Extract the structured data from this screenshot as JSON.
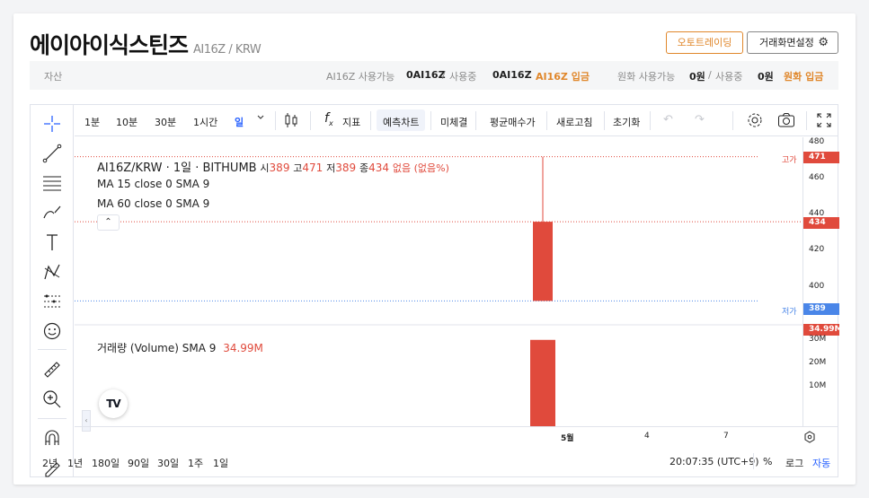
{
  "header": {
    "title": "에이아이식스틴즈",
    "pair": "AI16Z / KRW",
    "auto_trading_label": "오토트레이딩",
    "screen_settings_label": "거래화면설정"
  },
  "assets": {
    "label": "자산",
    "coin_available_label": "AI16Z 사용가능",
    "coin_available_value": "0AI16Z",
    "coin_used_label": "사용중",
    "coin_used_value": "0AI16Z",
    "coin_deposit_label": "AI16Z 입금",
    "krw_available_label": "원화 사용가능",
    "krw_available_value": "0원",
    "krw_used_label": "사용중",
    "krw_used_value": "0원",
    "krw_deposit_label": "원화 입금",
    "slash": "/"
  },
  "toolbar": {
    "intervals": [
      "1분",
      "10분",
      "30분",
      "1시간",
      "일"
    ],
    "selected_interval": "일",
    "indicators_label": "지표",
    "predict_chart_label": "예측차트",
    "unfilled_label": "미체결",
    "avg_price_label": "평균매수가",
    "refresh_label": "새로고침",
    "reset_label": "초기화"
  },
  "legend": {
    "symbol_line": "AI16Z/KRW · 1일 · BITHUMB",
    "open_label": "시",
    "open_value": "389",
    "high_label": "고",
    "high_value": "471",
    "low_label": "저",
    "low_value": "389",
    "close_label": "종",
    "close_value": "434",
    "change_text": "없음 (없음%)",
    "ma15": "MA 15 close 0 SMA 9",
    "ma60": "MA 60 close 0 SMA 9",
    "volume_label": "거래량 (Volume) SMA 9",
    "volume_value": "34.99M",
    "collapse_glyph": "⌃"
  },
  "price_axis": {
    "ticks": [
      "480",
      "460",
      "440",
      "420",
      "400"
    ],
    "high_tag_label": "고가",
    "high_tag_value": "471",
    "current_tag_value": "434",
    "low_tag_label": "저가",
    "low_tag_value": "389",
    "volume_tag_value": "34.99M",
    "volume_ticks": [
      "30M",
      "20M",
      "10M"
    ]
  },
  "time_axis": {
    "ticks": [
      "5월",
      "4",
      "7"
    ]
  },
  "bottom": {
    "ranges": [
      "2년",
      "1년",
      "180일",
      "90일",
      "30일",
      "1주",
      "1일"
    ],
    "clock": "20:07:35 (UTC+9)",
    "percent": "%",
    "log": "로그",
    "auto": "자동"
  },
  "logo_text": "TV",
  "colors": {
    "up": "#e04a3c",
    "accent_orange": "#e0872b",
    "blue_tag": "#4a86e8",
    "selected_blue": "#2962ff"
  },
  "chart_data": {
    "type": "candlestick",
    "candles": [
      {
        "open": 389,
        "high": 471,
        "low": 389,
        "close": 434,
        "volume": 34990000
      }
    ],
    "price_ylim": [
      380,
      482
    ],
    "volume_ylim": [
      0,
      40000000
    ]
  }
}
